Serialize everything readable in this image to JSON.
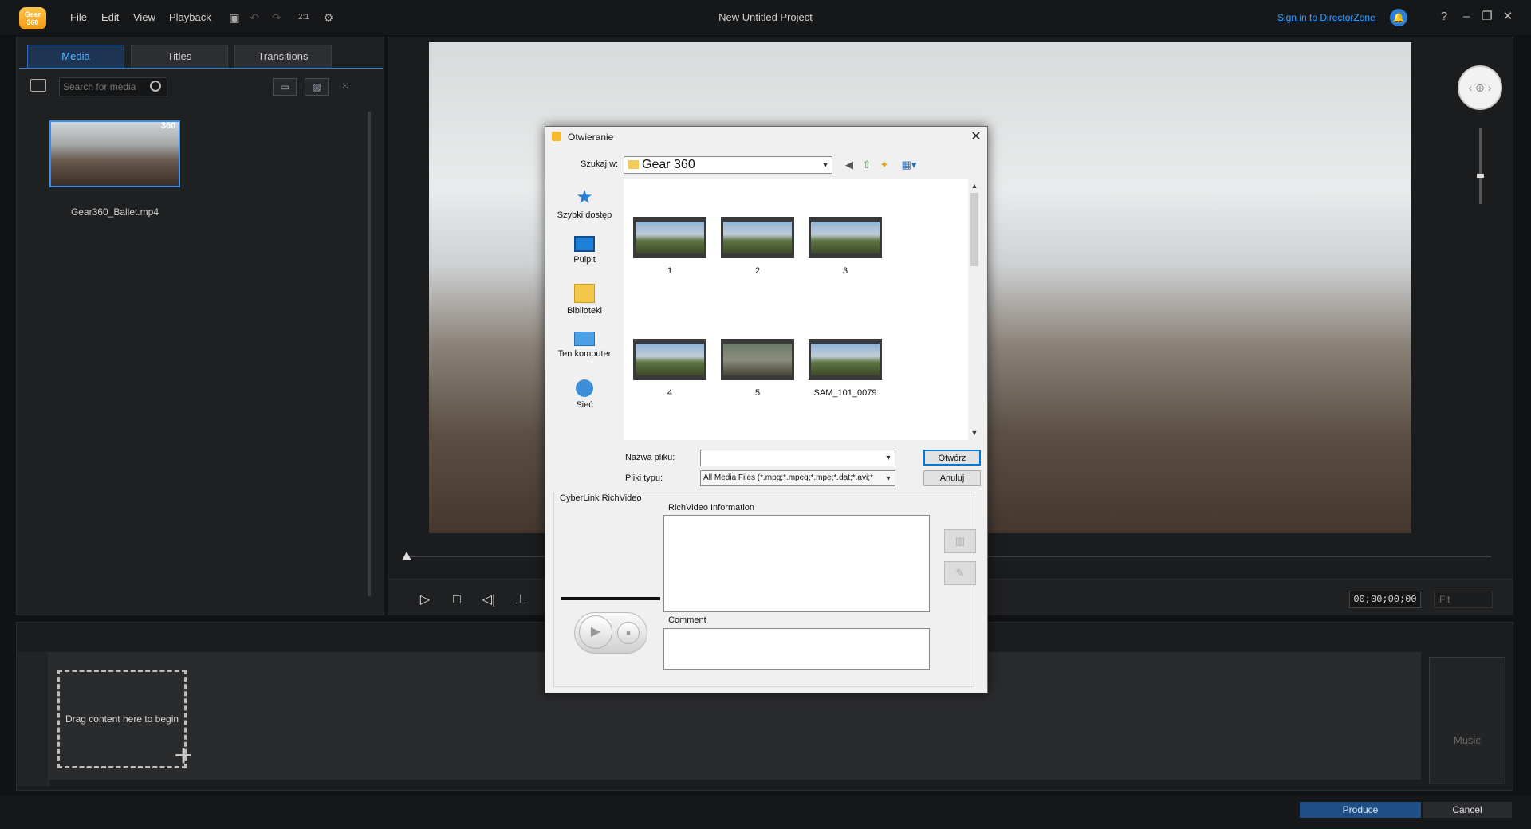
{
  "app": {
    "logo_text": "Gear\n360",
    "project_title": "New Untitled Project",
    "sign_in_label": "Sign in to DirectorZone",
    "menu": [
      "File",
      "Edit",
      "View",
      "Playback"
    ],
    "zoom_label": "2:1"
  },
  "media_panel": {
    "tabs": [
      "Media",
      "Titles",
      "Transitions"
    ],
    "active_tab": "Media",
    "search_placeholder": "Search for media",
    "items": [
      {
        "filename": "Gear360_Ballet.mp4",
        "badge": "360"
      }
    ]
  },
  "preview": {
    "timecode": "00;00;00;00",
    "fit_label": "Fit"
  },
  "timeline": {
    "drop_hint": "Drag content here to begin",
    "music_label": "Music"
  },
  "footer": {
    "produce_label": "Produce",
    "cancel_label": "Cancel"
  },
  "dialog": {
    "title": "Otwieranie",
    "look_in_label": "Szukaj w:",
    "look_in_value": "Gear 360",
    "places": [
      "Szybki dostęp",
      "Pulpit",
      "Biblioteki",
      "Ten komputer",
      "Sieć"
    ],
    "files": [
      "1",
      "2",
      "3",
      "4",
      "5",
      "SAM_101_0079"
    ],
    "filename_label": "Nazwa pliku:",
    "filename_value": "",
    "filetype_label": "Pliki typu:",
    "filetype_value": "All Media Files (*.mpg;*.mpeg;*.mpe;*.dat;*.avi;*",
    "open_label": "Otwórz",
    "cancel_label": "Anuluj",
    "richvideo": {
      "group_title": "CyberLink RichVideo",
      "info_label": "RichVideo Information",
      "comment_label": "Comment"
    }
  },
  "colors": {
    "accent": "#2f7fd4",
    "link": "#3ba0ff",
    "brand": "#f39a12"
  }
}
